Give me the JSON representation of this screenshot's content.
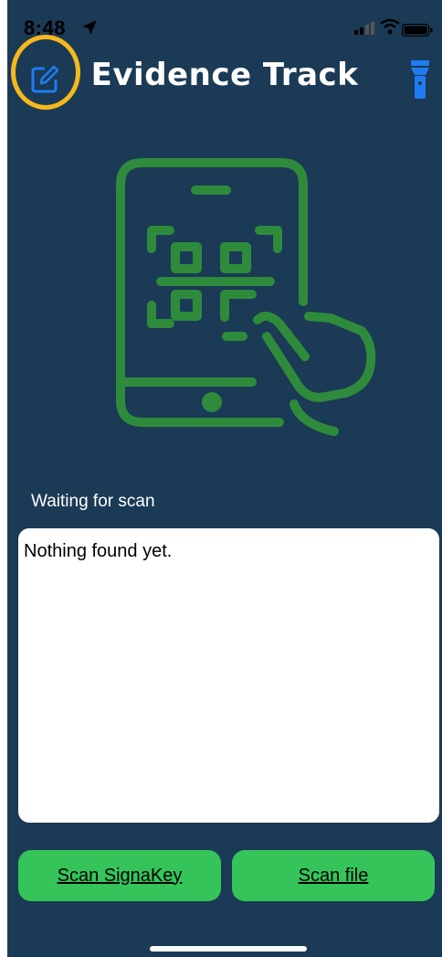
{
  "status_bar": {
    "time": "8:48",
    "icons": [
      "location-arrow-icon",
      "cellular-signal-icon",
      "wifi-icon",
      "battery-icon"
    ]
  },
  "nav": {
    "title": "Evidence Track",
    "left_icon": "edit-icon",
    "right_icon": "flashlight-icon"
  },
  "illustration": {
    "icon": "phone-qr-scan-illustration",
    "color": "#2e8b3c"
  },
  "scan": {
    "status_label": "Waiting for scan",
    "result_text": "Nothing found yet."
  },
  "buttons": {
    "scan_signakey": "Scan SignaKey",
    "scan_file": "Scan file"
  },
  "colors": {
    "background": "#1b3a55",
    "accent_blue": "#1e7cf2",
    "button_green": "#34c45a",
    "highlight_ring": "#f6b81c"
  }
}
